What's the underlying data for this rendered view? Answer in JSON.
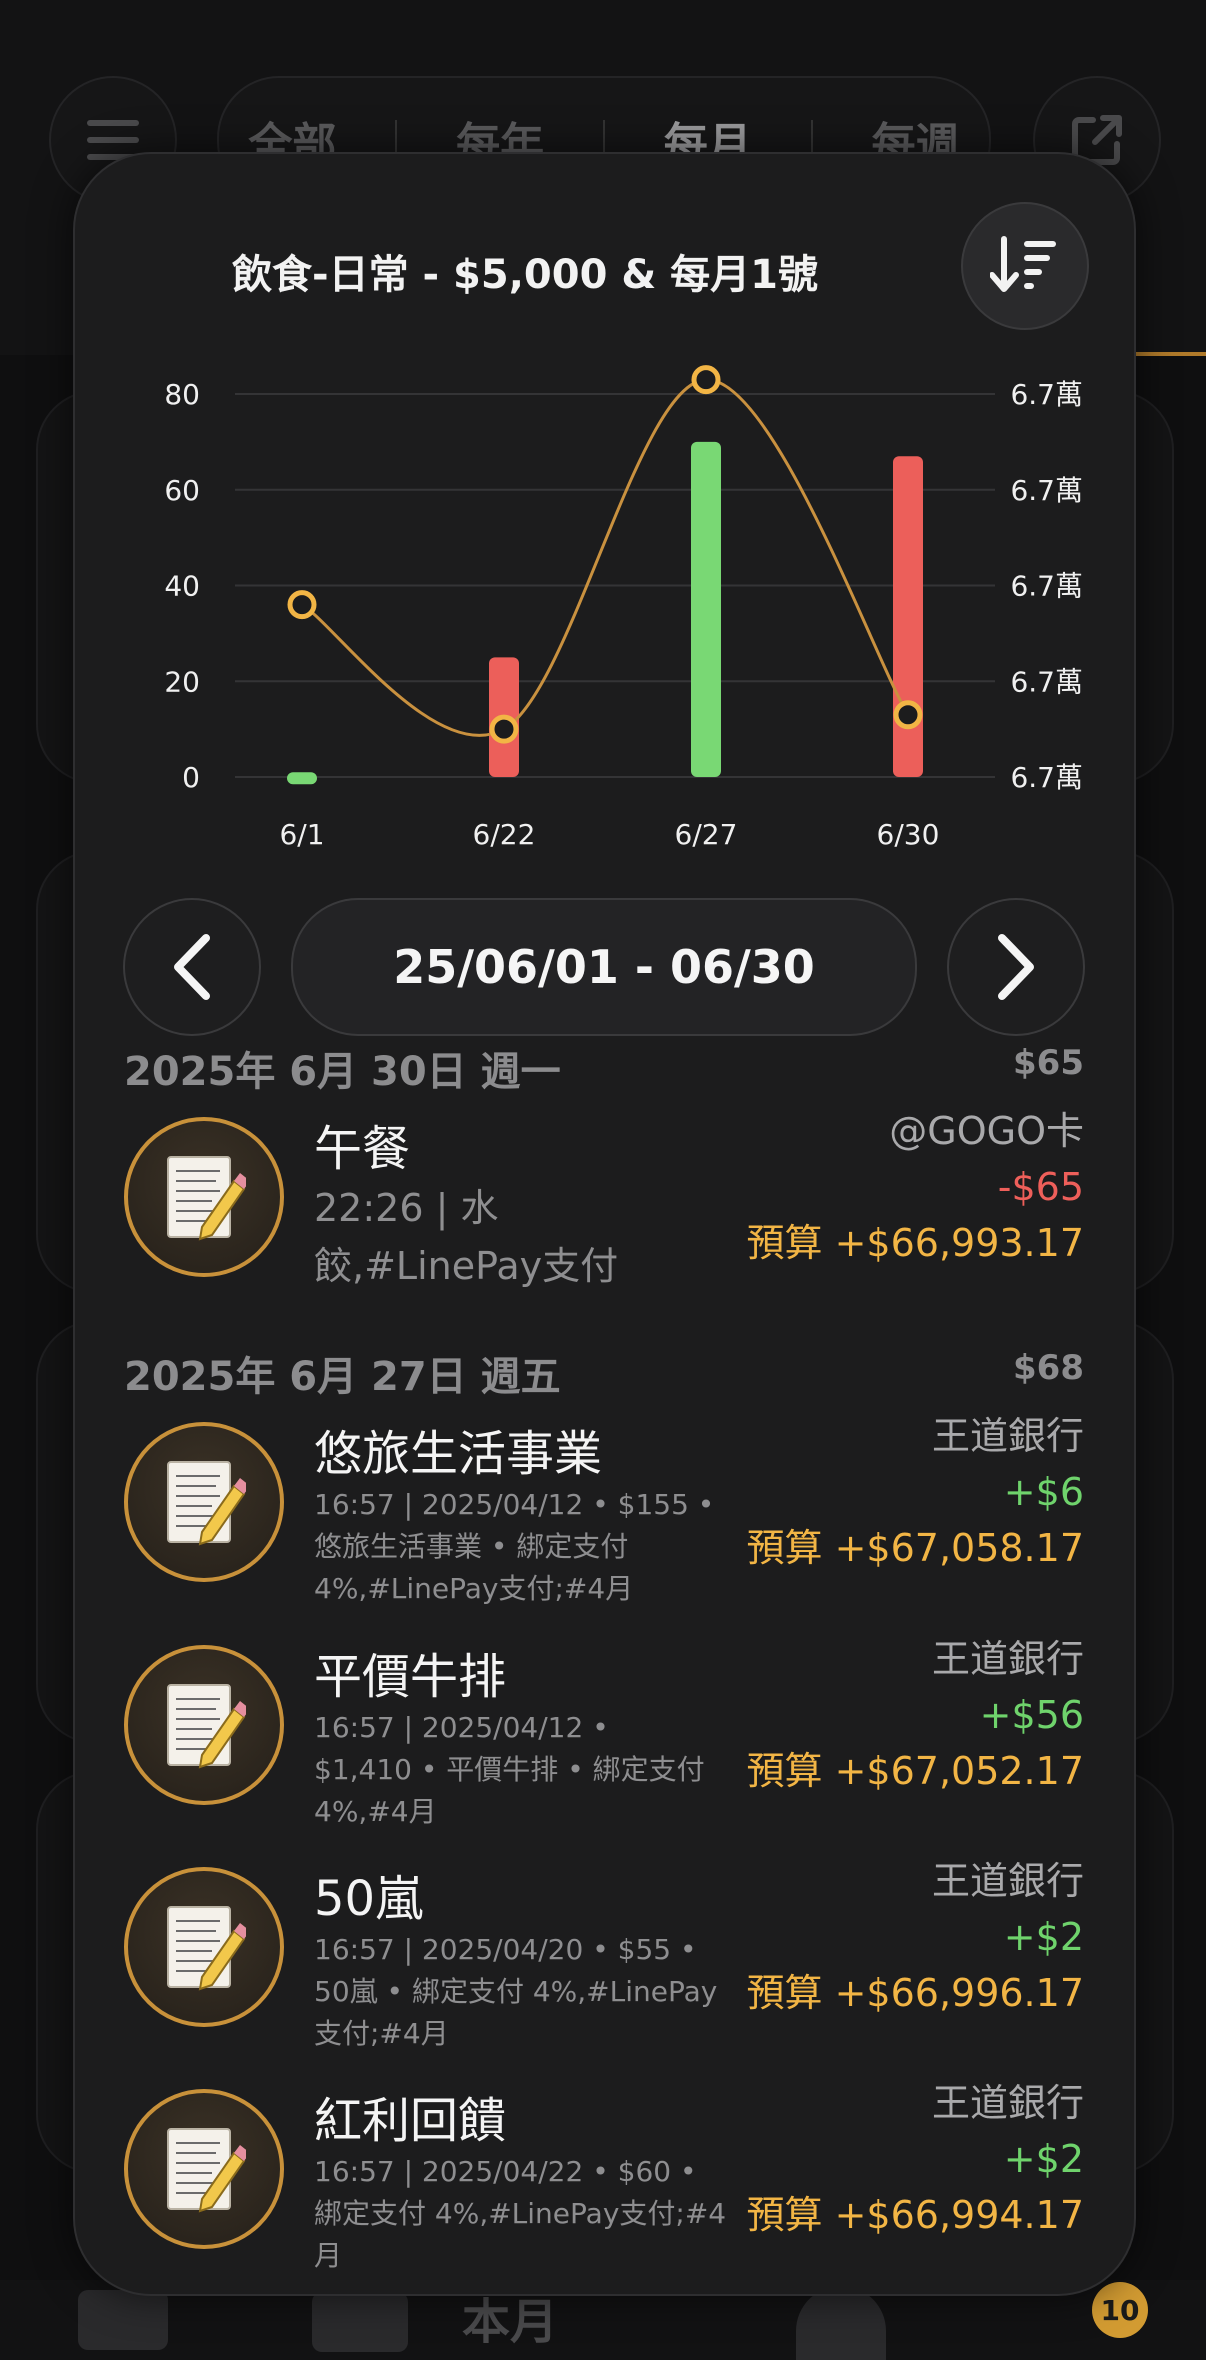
{
  "background": {
    "tabs": [
      "全部",
      "每年",
      "每月",
      "每週"
    ],
    "active_tab": "每月",
    "bottom_nav": {
      "home_label": "本月",
      "notification_count": "10"
    }
  },
  "modal": {
    "title": "飲食-日常 - $5,000 & 每月1號",
    "date_range": "25/06/01 - 06/30"
  },
  "chart_data": {
    "type": "bar",
    "categories": [
      "6/1",
      "6/22",
      "6/27",
      "6/30"
    ],
    "series": [
      {
        "type": "bar",
        "values": [
          1,
          25,
          70,
          67
        ],
        "colors": [
          "#79d874",
          "#ec5f5a",
          "#79d874",
          "#ec5f5a"
        ]
      },
      {
        "type": "line",
        "values": [
          36,
          10,
          83,
          13
        ],
        "color": "#c9913f"
      }
    ],
    "y_left_ticks": [
      "0",
      "20",
      "40",
      "60",
      "80"
    ],
    "y_right_ticks": [
      "6.7萬",
      "6.7萬",
      "6.7萬",
      "6.7萬",
      "6.7萬"
    ],
    "ylim": [
      0,
      80
    ],
    "grid": true
  },
  "groups": [
    {
      "date": "2025年 6月 30日 週一",
      "total": "$65",
      "items": [
        {
          "title": "午餐",
          "detail": [
            "22:26 | 水",
            "餃,#LinePay支付"
          ],
          "account": "@GOGO卡",
          "amount": "-$65",
          "sign": "neg",
          "budget": "預算 +$66,993.17"
        }
      ]
    },
    {
      "date": "2025年 6月 27日 週五",
      "total": "$68",
      "items": [
        {
          "title": "悠旅生活事業",
          "detail": [
            "16:57 | 2025/04/12 • $155 •",
            "悠旅生活事業 • 綁定支付",
            "4%,#LinePay支付;#4月"
          ],
          "account": "王道銀行",
          "amount": "+$6",
          "sign": "pos",
          "budget": "預算 +$67,058.17"
        },
        {
          "title": "平價牛排",
          "detail": [
            "16:57 | 2025/04/12 •",
            "$1,410 • 平價牛排 • 綁定支付",
            "4%,#4月"
          ],
          "account": "王道銀行",
          "amount": "+$56",
          "sign": "pos",
          "budget": "預算 +$67,052.17"
        },
        {
          "title": "50嵐",
          "detail": [
            "16:57 | 2025/04/20 • $55 •",
            "50嵐 • 綁定支付 4%,#LinePay",
            "支付;#4月"
          ],
          "account": "王道銀行",
          "amount": "+$2",
          "sign": "pos",
          "budget": "預算 +$66,996.17"
        },
        {
          "title": "紅利回饋",
          "detail": [
            "16:57 | 2025/04/22 • $60 •",
            "綁定支付 4%,#LinePay支付;#4",
            "月"
          ],
          "account": "王道銀行",
          "amount": "+$2",
          "sign": "pos",
          "budget": "預算 +$66,994.17"
        }
      ]
    }
  ]
}
